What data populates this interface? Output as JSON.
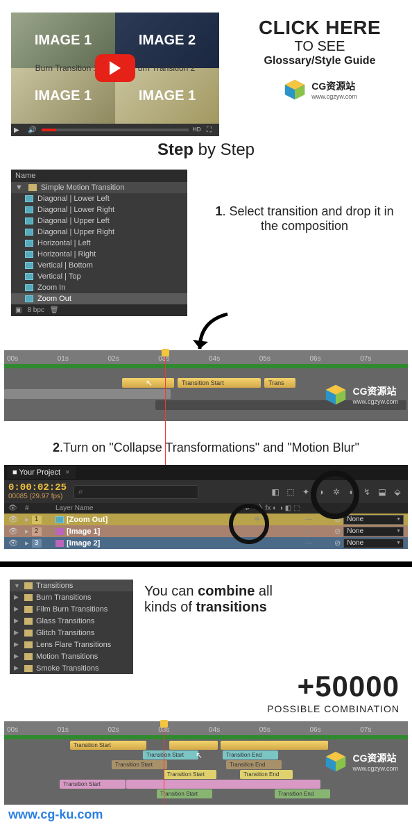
{
  "top": {
    "video_labels": [
      "IMAGE 1",
      "IMAGE 2",
      "IMAGE 1",
      "IMAGE 1"
    ],
    "burn": [
      "Burn Transition 1",
      "urn Transition 2"
    ]
  },
  "cta": {
    "click": "CLICK HERE",
    "tosee": "TO SEE",
    "glossary": "Glossary/Style Guide"
  },
  "watermark": {
    "zh": "CG资源站",
    "url": "www.cgzyw.com"
  },
  "heading": {
    "step": "Step",
    "by": "by Step"
  },
  "project": {
    "name_col": "Name",
    "root": "Simple Motion Transition",
    "items": [
      "Diagonal | Lower Left",
      "Diagonal | Lower Right",
      "Diagonal | Upper Left",
      "Diagonal | Upper Right",
      "Horizontal | Left",
      "Horizontal | Right",
      "Vertical | Bottom",
      "Vertical | Top",
      "Zoom In",
      "Zoom Out"
    ],
    "bpc": "8 bpc"
  },
  "step1": {
    "num": "1",
    "text": ". Select transition and drop it in the composition"
  },
  "timeline": {
    "ticks": [
      "00s",
      "01s",
      "02s",
      "03s",
      "04s",
      "05s",
      "06s",
      "07s"
    ],
    "start": "Transition Start",
    "trans": "Trans"
  },
  "step2": {
    "num": "2",
    "text": ".Turn on \"Collapse Transformations\" and \"Motion Blur\""
  },
  "ae": {
    "tab": "Your Project",
    "tc": "0:00:02:25",
    "fps": "00085 (29.97 fps)",
    "search_ph": "⌕",
    "layer_col": "Layer Name",
    "num_col": "#",
    "layers": [
      {
        "n": "1",
        "name": "[Zoom Out]",
        "type": "comp",
        "mode": "None"
      },
      {
        "n": "2",
        "name": "[Image 1]",
        "type": "img",
        "mode": "None"
      },
      {
        "n": "3",
        "name": "[Image 2]",
        "type": "img",
        "mode": "None"
      }
    ]
  },
  "transitions": {
    "root": "Transitions",
    "folders": [
      "Burn Transitions",
      "Film Burn Transitions",
      "Glass Transitions",
      "Glitch Transitions",
      "Lens Flare Transitions",
      "Motion Transitions",
      "Smoke Transitions"
    ]
  },
  "combine": {
    "l1a": "You can ",
    "l1b": "combine",
    "l1c": " all",
    "l2a": "kinds of ",
    "l2b": "transitions"
  },
  "fifty": {
    "big": "+50000",
    "sub": "POSSIBLE COMBINATION"
  },
  "timeline2": {
    "ticks": [
      "00s",
      "01s",
      "02s",
      "03s",
      "04s",
      "05s",
      "06s",
      "07s"
    ],
    "ts": "Transition Start",
    "te": "Transition End"
  },
  "footer": {
    "url": "www.cg-ku.com"
  }
}
